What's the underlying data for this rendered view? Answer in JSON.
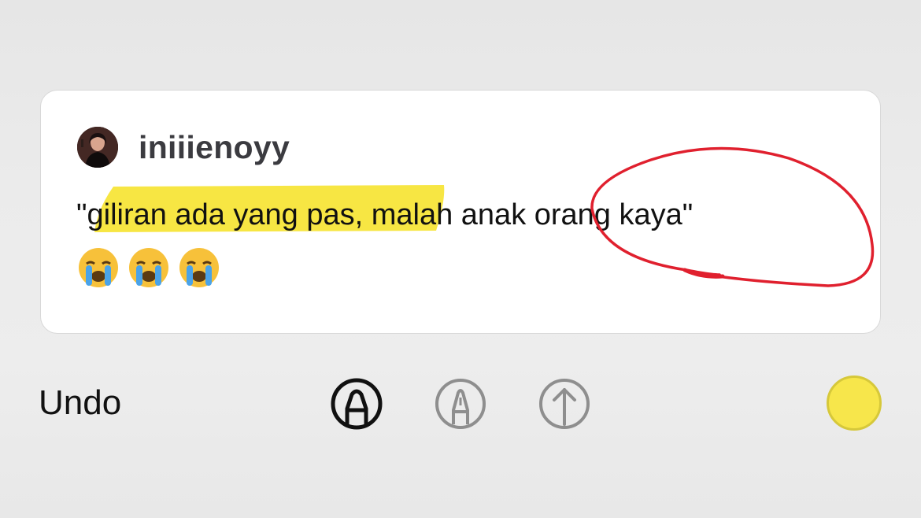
{
  "post": {
    "username": "iniiienoyy",
    "quote": "\"giliran ada yang pas, malah anak orang kaya\"",
    "emojis": [
      "😭",
      "😭",
      "😭"
    ]
  },
  "annotations": {
    "highlight_color": "#f7e643",
    "highlighted_text": "giliran ada yang pas,",
    "circle_color": "#e0202e",
    "circled_text": "orang kaya"
  },
  "toolbar": {
    "undo_label": "Undo",
    "tools": [
      {
        "name": "pen",
        "selected": true
      },
      {
        "name": "marker",
        "selected": false
      },
      {
        "name": "arrow",
        "selected": false
      }
    ],
    "selected_color": "#f7e64b"
  }
}
